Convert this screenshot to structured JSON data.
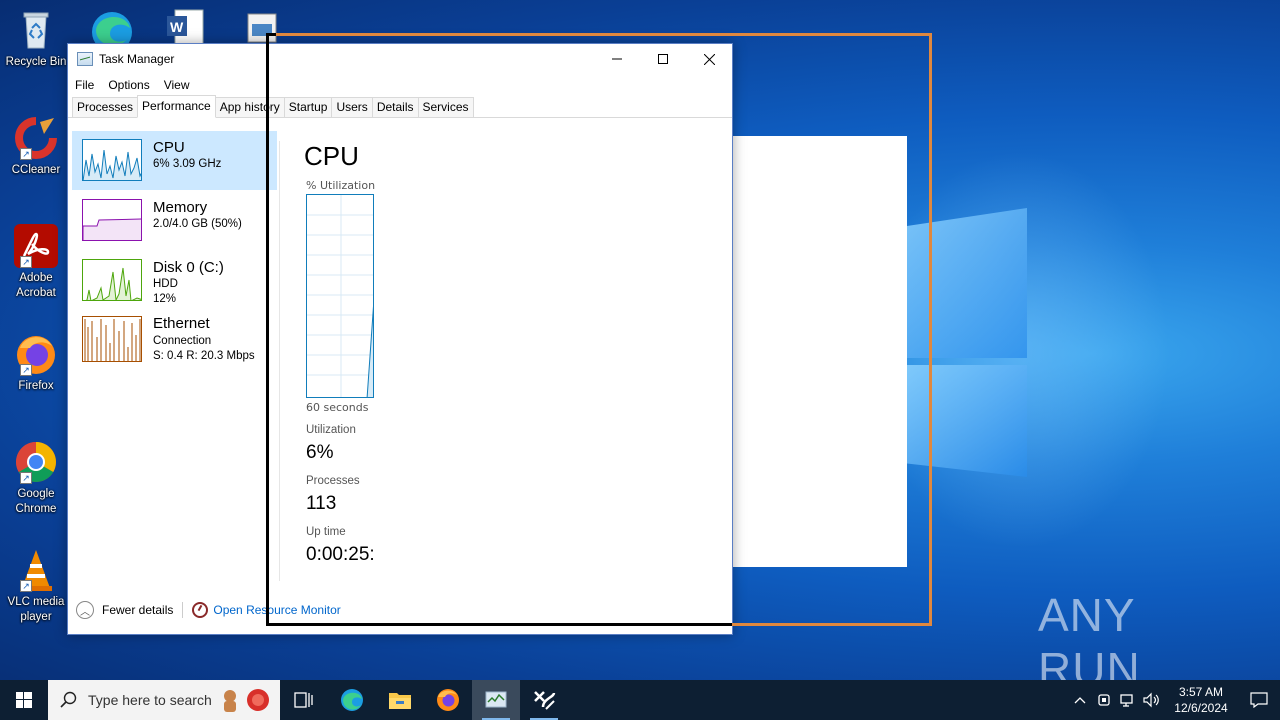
{
  "desktop": {
    "icons": [
      {
        "label": "Recycle Bin",
        "icon": "recycle-bin-icon"
      },
      {
        "label": "CCleaner",
        "icon": "ccleaner-icon"
      },
      {
        "label": "Adobe Acrobat",
        "icon": "adobe-acrobat-icon"
      },
      {
        "label": "Firefox",
        "icon": "firefox-icon"
      },
      {
        "label": "Google Chrome",
        "icon": "chrome-icon"
      },
      {
        "label": "VLC media player",
        "icon": "vlc-icon"
      }
    ],
    "watermark": "ANY RUN"
  },
  "window": {
    "title": "Task Manager",
    "menu": [
      "File",
      "Options",
      "View"
    ],
    "tabs": [
      "Processes",
      "Performance",
      "App history",
      "Startup",
      "Users",
      "Details",
      "Services"
    ],
    "active_tab": "Performance"
  },
  "sidebar": [
    {
      "name": "CPU",
      "line1": "6%  3.09 GHz",
      "line2": "",
      "color": "#117dbb"
    },
    {
      "name": "Memory",
      "line1": "2.0/4.0 GB (50%)",
      "line2": "",
      "color": "#8b12ae"
    },
    {
      "name": "Disk 0 (C:)",
      "line1": "HDD",
      "line2": "12%",
      "color": "#4da60c"
    },
    {
      "name": "Ethernet",
      "line1": "Connection",
      "line2": "S: 0.4  R: 20.3 Mbps",
      "color": "#a74f01"
    }
  ],
  "main": {
    "title": "CPU",
    "graph_label": "% Utilization",
    "graph_note": "60 seconds",
    "stats": [
      {
        "label": "Utilization",
        "value": "6%"
      },
      {
        "label": "Processes",
        "value": "113"
      },
      {
        "label": "Up time",
        "value": "0:00:25:"
      }
    ]
  },
  "footer": {
    "fewer_details": "Fewer details",
    "resource_monitor": "Open Resource Monitor"
  },
  "taskbar": {
    "search_placeholder": "Type here to search",
    "time": "3:57 AM",
    "date": "12/6/2024"
  },
  "colors": {
    "cpu": "#117dbb",
    "memory": "#8b12ae",
    "disk": "#4da60c",
    "ethernet": "#a74f01",
    "selection_orange": "#e0883e"
  }
}
